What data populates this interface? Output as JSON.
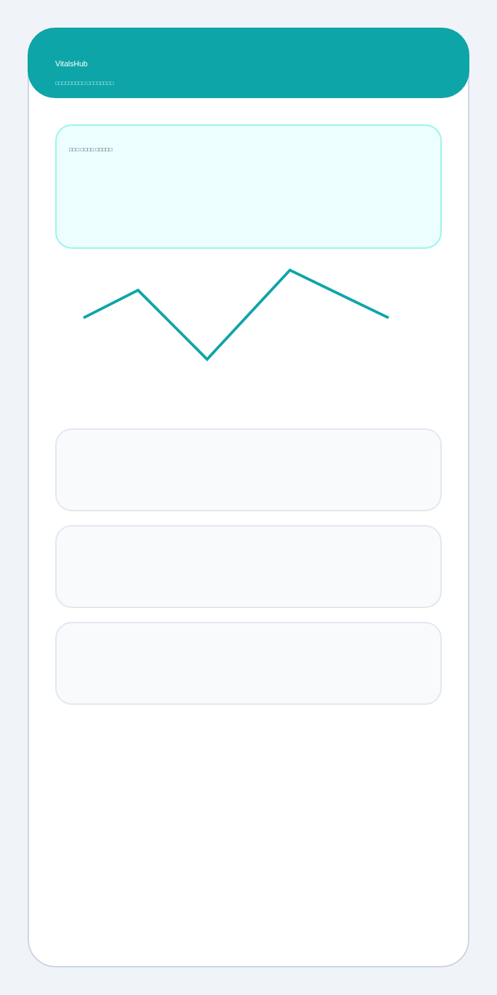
{
  "header": {
    "title": "VitalsHub",
    "subtitle": "□□□□□□□□□ □□□□□□□□"
  },
  "summary_card": {
    "title": "□□□ □□□□ □□□□□"
  }
}
